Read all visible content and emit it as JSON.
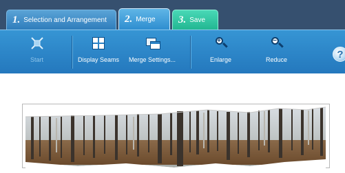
{
  "tabs": [
    {
      "number": "1.",
      "label": "Selection and Arrangement"
    },
    {
      "number": "2.",
      "label": "Merge"
    },
    {
      "number": "3.",
      "label": "Save"
    }
  ],
  "toolbar": {
    "start": "Start",
    "display_seams": "Display Seams",
    "merge_settings": "Merge Settings...",
    "enlarge": "Enlarge",
    "reduce": "Reduce",
    "help": "?"
  },
  "colors": {
    "tab_bar": "#36506f",
    "toolbar": "#2a84c8",
    "tab_save": "#2cc6a0"
  },
  "icons": [
    "start-icon",
    "display-seams-icon",
    "merge-settings-icon",
    "zoom-in-icon",
    "zoom-out-icon",
    "help-icon"
  ]
}
